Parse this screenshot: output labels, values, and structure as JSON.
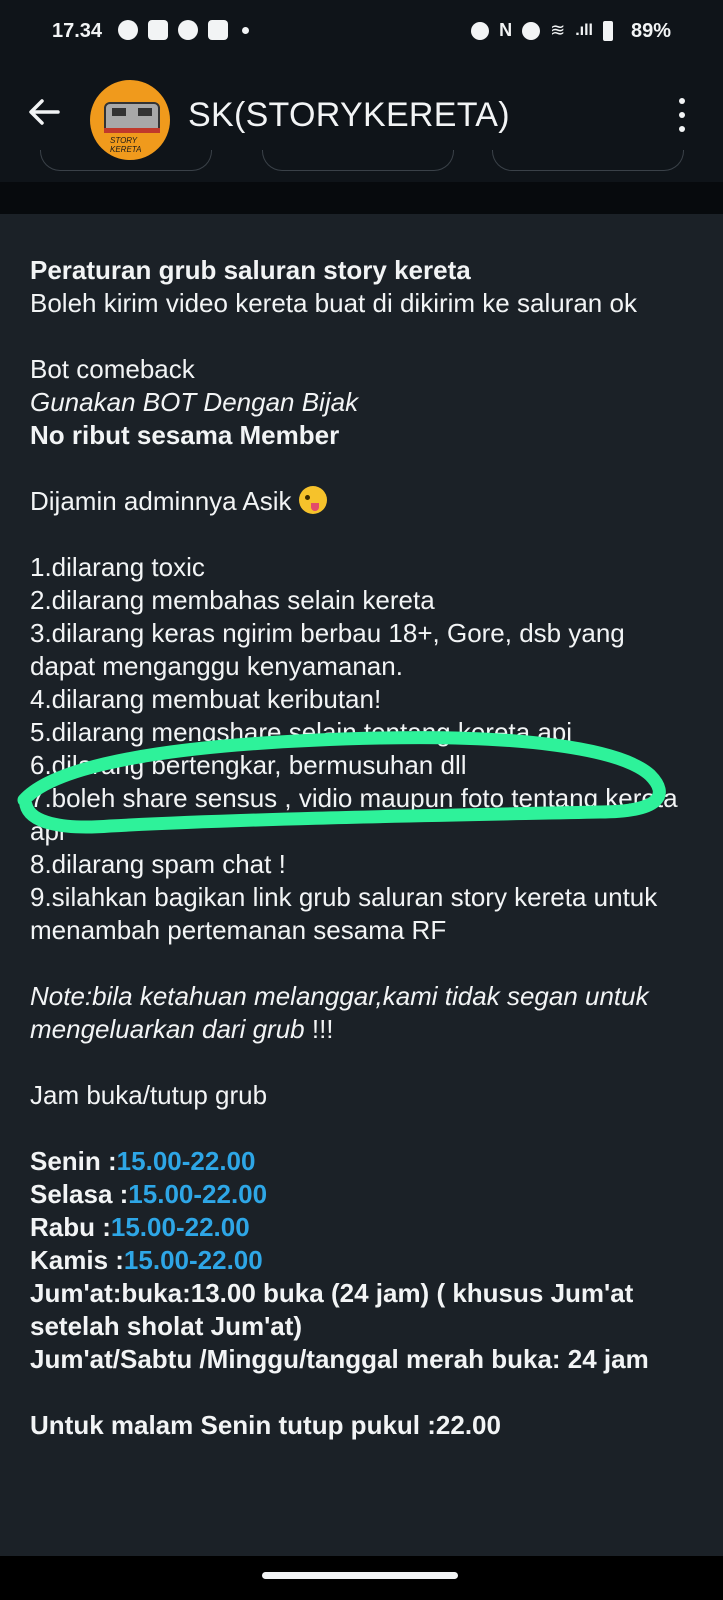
{
  "status_bar": {
    "time": "17.34",
    "battery": "89%",
    "left_icons": [
      "messenger-icon",
      "mail-icon",
      "shopee-icon",
      "mail-icon"
    ],
    "right_icons": [
      "add-circle-icon",
      "nfc-icon",
      "do-not-disturb-icon",
      "wifi-icon",
      "signal-icon",
      "battery-icon"
    ]
  },
  "header": {
    "title": "SK(STORYKERETA)",
    "avatar_text": "STORY KERETA"
  },
  "message": {
    "rules_title": "Peraturan grub saluran story kereta",
    "intro": "Boleh kirim video kereta buat di dikirim ke saluran ok",
    "bot_line": "Bot comeback",
    "bot_italic": "Gunakan BOT Dengan Bijak",
    "no_ribut": "No ribut sesama Member",
    "admin_line": "Dijamin adminnya Asik",
    "rules": [
      "1.dilarang toxic",
      "2.dilarang membahas selain kereta",
      "3.dilarang keras ngirim berbau 18+, Gore, dsb yang dapat menganggu kenyamanan.",
      "4.dilarang membuat keributan!",
      "5.dilarang mengshare selain tentang kereta api",
      "6.dilarang bertengkar, bermusuhan dll",
      "7.boleh share sensus , vidio maupun foto tentang kereta api",
      "8.dilarang spam chat !",
      "9.silahkan bagikan link grub saluran story kereta untuk menambah pertemanan sesama RF"
    ],
    "note_italic": "Note:bila ketahuan melanggar,kami tidak segan untuk mengeluarkan dari grub",
    "note_suffix": " !!!",
    "hours_title": "Jam buka/tutup grub",
    "schedule": [
      {
        "day": "Senin :",
        "time": "15.00-22.00"
      },
      {
        "day": "Selasa :",
        "time": "15.00-22.00"
      },
      {
        "day": "Rabu :",
        "time": "15.00-22.00"
      },
      {
        "day": "Kamis :",
        "time": "15.00-22.00"
      }
    ],
    "jumat": "Jum'at:buka:13.00 buka (24 jam) ( khusus Jum'at setelah sholat Jum'at)",
    "weekend": "Jum'at/Sabtu /Minggu/tanggal merah  buka: 24 jam",
    "closing": "Untuk malam Senin tutup pukul :22.00"
  },
  "colors": {
    "background": "#0f1419",
    "card": "#1b2127",
    "link_blue": "#2ea6e6",
    "highlight_green": "#2ef29a"
  }
}
